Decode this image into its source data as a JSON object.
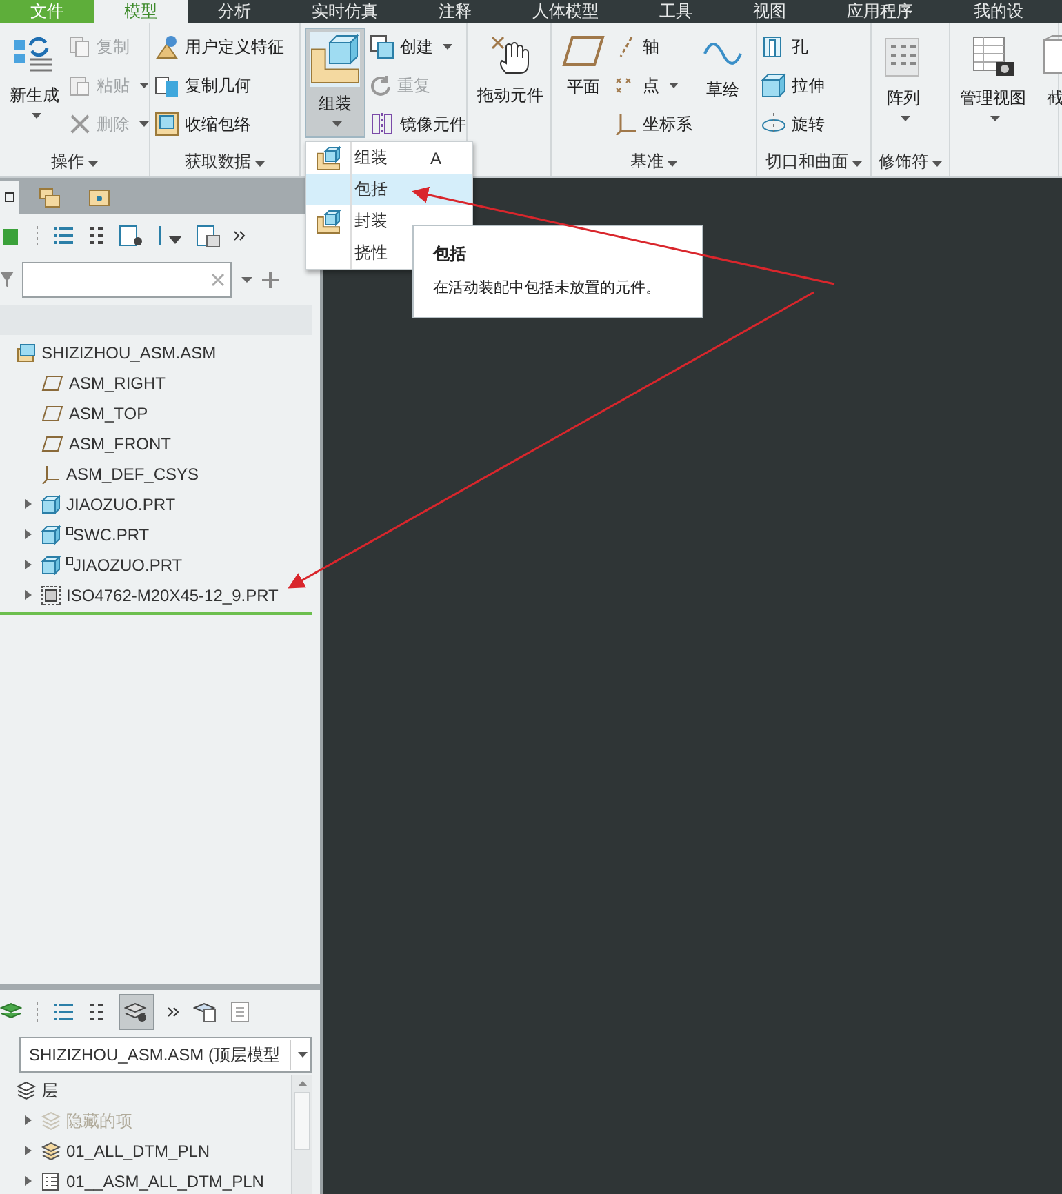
{
  "tabs": [
    {
      "label": "文件",
      "kind": "file",
      "selected": false
    },
    {
      "label": "模型",
      "kind": "tab",
      "selected": true
    },
    {
      "label": "分析",
      "kind": "tab",
      "selected": false
    },
    {
      "label": "实时仿真",
      "kind": "tab",
      "selected": false
    },
    {
      "label": "注释",
      "kind": "tab",
      "selected": false
    },
    {
      "label": "人体模型",
      "kind": "tab",
      "selected": false
    },
    {
      "label": "工具",
      "kind": "tab",
      "selected": false
    },
    {
      "label": "视图",
      "kind": "tab",
      "selected": false
    },
    {
      "label": "应用程序",
      "kind": "tab",
      "selected": false
    },
    {
      "label": "我的设",
      "kind": "tab",
      "selected": false
    }
  ],
  "ribbon": {
    "groups": [
      {
        "label": "操作",
        "dropdown": true,
        "items": [
          {
            "label": "新生成",
            "kind": "large",
            "dropdown": true,
            "disabled": false,
            "pressed": false
          },
          {
            "label": "复制",
            "kind": "small",
            "dropdown": false,
            "disabled": true
          },
          {
            "label": "粘贴",
            "kind": "small",
            "dropdown": true,
            "disabled": true
          },
          {
            "label": "删除",
            "kind": "small",
            "dropdown": true,
            "disabled": true
          }
        ]
      },
      {
        "label": "获取数据",
        "dropdown": true,
        "items": [
          {
            "label": "用户定义特征",
            "kind": "small",
            "dropdown": false,
            "disabled": false
          },
          {
            "label": "复制几何",
            "kind": "small",
            "dropdown": false,
            "disabled": false
          },
          {
            "label": "收缩包络",
            "kind": "small",
            "dropdown": false,
            "disabled": false
          }
        ]
      },
      {
        "items": [
          {
            "label": "组装",
            "kind": "large",
            "dropdown": true,
            "disabled": false,
            "pressed": true
          },
          {
            "label": "创建",
            "kind": "small",
            "dropdown": true,
            "disabled": false
          },
          {
            "label": "重复",
            "kind": "small",
            "dropdown": false,
            "disabled": true
          },
          {
            "label": "镜像元件",
            "kind": "small",
            "dropdown": false,
            "disabled": false
          }
        ]
      },
      {
        "items": [
          {
            "label": "拖动元件",
            "kind": "large",
            "dropdown": false,
            "disabled": false,
            "pressed": false
          }
        ]
      },
      {
        "label": "基准",
        "dropdown": true,
        "items": [
          {
            "label": "平面",
            "kind": "large",
            "dropdown": false,
            "disabled": false,
            "pressed": false
          },
          {
            "label": "轴",
            "kind": "small",
            "dropdown": false,
            "disabled": false
          },
          {
            "label": "点",
            "kind": "small",
            "dropdown": true,
            "disabled": false
          },
          {
            "label": "坐标系",
            "kind": "small",
            "dropdown": false,
            "disabled": false
          },
          {
            "label": "草绘",
            "kind": "large",
            "dropdown": false,
            "disabled": false,
            "pressed": false
          }
        ]
      },
      {
        "label": "切口和曲面",
        "dropdown": true,
        "items": [
          {
            "label": "孔",
            "kind": "small",
            "dropdown": false,
            "disabled": false
          },
          {
            "label": "拉伸",
            "kind": "small",
            "dropdown": false,
            "disabled": false
          },
          {
            "label": "旋转",
            "kind": "small",
            "dropdown": false,
            "disabled": false
          }
        ]
      },
      {
        "label": "修饰符",
        "dropdown": true,
        "items": [
          {
            "label": "阵列",
            "kind": "large",
            "dropdown": true,
            "disabled": false,
            "pressed": false
          }
        ]
      },
      {
        "items": [
          {
            "label": "管理视图",
            "kind": "large",
            "dropdown": true,
            "disabled": false,
            "pressed": false
          },
          {
            "label": "截",
            "kind": "large",
            "dropdown": false,
            "disabled": false,
            "pressed": false
          }
        ]
      }
    ]
  },
  "menu": {
    "items": [
      {
        "label": "组装",
        "shortcut": "A",
        "kind": "icon",
        "selected": false
      },
      {
        "label": "包括",
        "kind": "plain",
        "selected": true
      },
      {
        "label": "封装",
        "kind": "icon",
        "selected": false
      },
      {
        "label": "挠性",
        "kind": "plain",
        "selected": false
      }
    ]
  },
  "tooltip": {
    "title": "包括",
    "text": "在活动装配中包括未放置的元件。"
  },
  "model_tree": {
    "items": [
      {
        "label": "SHIZIZHOU_ASM.ASM",
        "kind": "assembly",
        "collapsed": false,
        "marked": false,
        "children": [
          {
            "label": "ASM_RIGHT",
            "kind": "datum-plane",
            "collapsed": false,
            "marked": false
          },
          {
            "label": "ASM_TOP",
            "kind": "datum-plane",
            "collapsed": false,
            "marked": false
          },
          {
            "label": "ASM_FRONT",
            "kind": "datum-plane",
            "collapsed": false,
            "marked": false
          },
          {
            "label": "ASM_DEF_CSYS",
            "kind": "csys",
            "collapsed": false,
            "marked": false
          },
          {
            "label": "JIAOZUO.PRT",
            "kind": "part",
            "collapsed": true,
            "marked": false
          },
          {
            "label": "SWC.PRT",
            "kind": "part",
            "collapsed": true,
            "marked": true
          },
          {
            "label": "JIAOZUO.PRT",
            "kind": "part",
            "collapsed": true,
            "marked": true
          },
          {
            "label": "ISO4762-M20X45-12_9.PRT",
            "kind": "fastener",
            "collapsed": true,
            "marked": false
          }
        ]
      }
    ]
  },
  "layers": {
    "display_pressed": true,
    "model": "SHIZIZHOU_ASM.ASM (顶层模型",
    "items": [
      {
        "label": "层",
        "kind": "root",
        "collapsed": false,
        "disabled": false,
        "children": [
          {
            "label": "隐藏的项",
            "kind": "hidden",
            "collapsed": true,
            "disabled": true
          },
          {
            "label": "01_ALL_DTM_PLN",
            "kind": "layer",
            "collapsed": true,
            "disabled": false
          },
          {
            "label": "01__ASM_ALL_DTM_PLN",
            "kind": "rule-layer",
            "collapsed": true,
            "disabled": false
          }
        ]
      }
    ]
  }
}
